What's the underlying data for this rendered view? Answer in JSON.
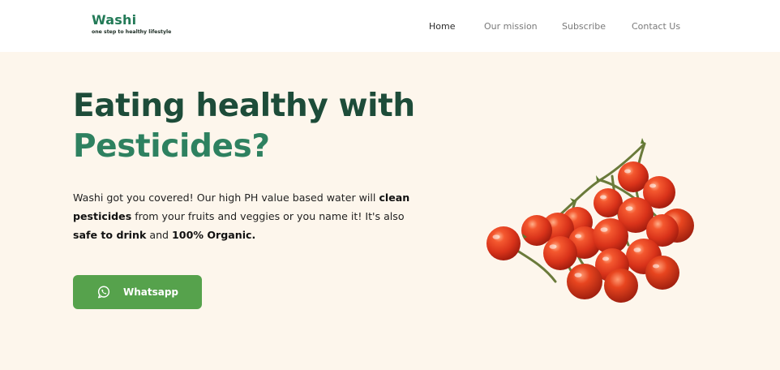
{
  "brand": {
    "name": "Washi",
    "tagline": "one step to healthy lifestyle"
  },
  "nav": {
    "items": [
      {
        "label": "Home",
        "active": true
      },
      {
        "label": "Our mission",
        "active": false
      },
      {
        "label": "Subscribe",
        "active": false
      },
      {
        "label": "Contact Us",
        "active": false
      }
    ]
  },
  "hero": {
    "headline_line1": "Eating healthy with",
    "headline_line2": "Pesticides?",
    "description": {
      "t1": "Washi got you covered! Our high PH value based water will ",
      "b1": "clean pesticides",
      "t2": " from your fruits and veggies or you name it! It's also ",
      "b2": "safe to drink",
      "t3": " and ",
      "b3": "100% Organic."
    },
    "cta_label": "Whatsapp",
    "cta_icon": "whatsapp-icon",
    "image": "cherry-tomatoes-bunch"
  },
  "colors": {
    "brand_green": "#237a57",
    "headline_dark": "#1d4c39",
    "headline_green": "#2e8160",
    "hero_background": "#fdf6ec",
    "button_green": "#56a24c",
    "tomato_red": "#d9331a"
  }
}
